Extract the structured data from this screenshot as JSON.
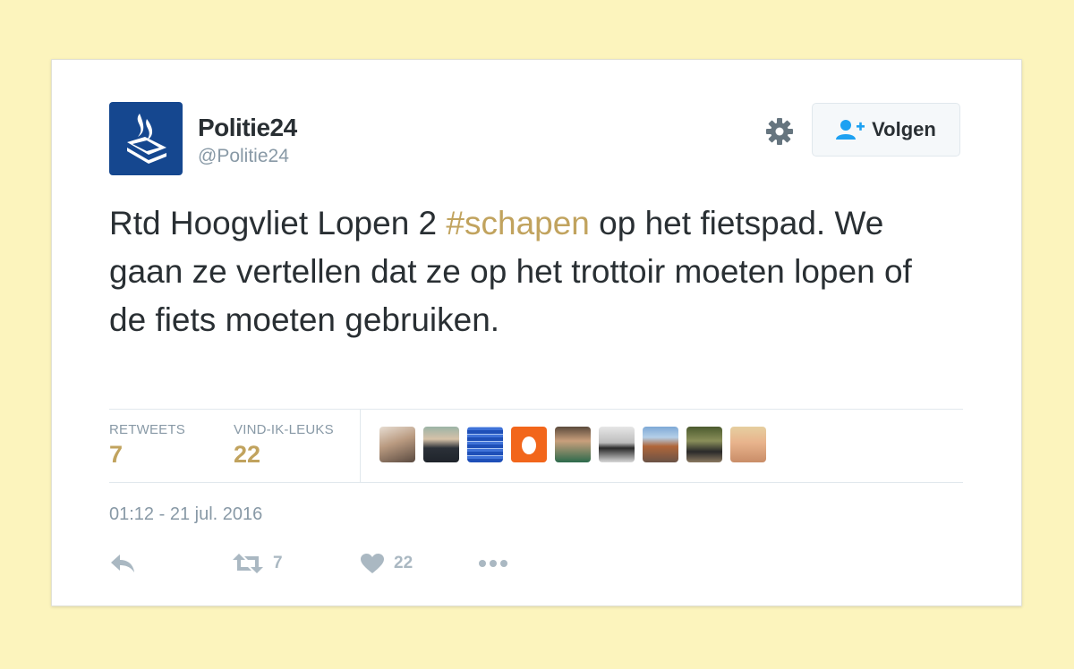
{
  "tweet": {
    "author_name": "Politie24",
    "author_handle": "@Politie24",
    "follow_label": "Volgen",
    "text_before": "Rtd Hoogvliet Lopen 2 ",
    "hashtag": "#schapen",
    "text_after": " op het fietspad. We gaan ze vertellen dat ze op het trottoir moeten lopen of de fiets moeten gebruiken.",
    "timestamp": "01:12 - 21 jul. 2016"
  },
  "stats": {
    "retweets_label": "RETWEETS",
    "retweets_value": "7",
    "likes_label": "VIND-IK-LEUKS",
    "likes_value": "22"
  },
  "actions": {
    "retweet_count": "7",
    "like_count": "22"
  },
  "icons": {
    "settings": "gear-icon",
    "follow": "add-user-icon",
    "reply": "reply-icon",
    "retweet": "retweet-icon",
    "like": "heart-icon",
    "more": "more-icon"
  },
  "colors": {
    "background": "#fcf4bd",
    "accent": "#c1a35e",
    "brand_blue": "#15478f",
    "muted": "#8899a6",
    "text": "#292f33"
  }
}
